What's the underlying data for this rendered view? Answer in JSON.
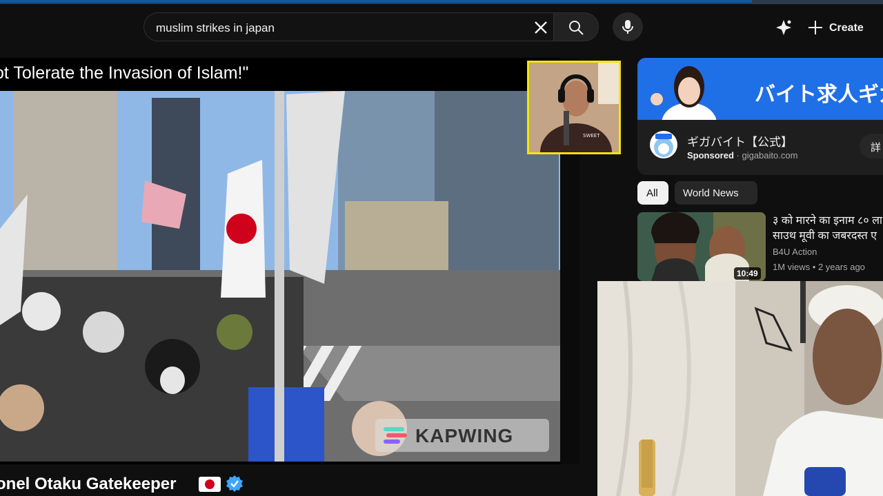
{
  "search": {
    "query": "muslim strikes in japan"
  },
  "masthead": {
    "create_label": "Create"
  },
  "player": {
    "clip_title": "ot Tolerate the Invasion of Islam!\"",
    "watermark": "KAPWING",
    "channel_name": "onel Otaku Gatekeeper"
  },
  "ad": {
    "banner_text": "バイト求人ギガたく",
    "title": "ギガバイト【公式】",
    "sponsored": "Sponsored",
    "domain": "gigabaito.com",
    "button": "詳"
  },
  "chips": [
    "All",
    "World News"
  ],
  "recommendation": {
    "title_line1": "३ को मारने का इनाम ८० ला",
    "title_line2": "साउथ मूवी का जबरदस्त ए",
    "channel": "B4U Action",
    "views": "1M views",
    "age": "2 years ago",
    "duration": "10:49"
  },
  "colors": {
    "webcam_border": "#f3e600",
    "verified": "#3ea6ff",
    "ad_banner": "#1f6fe6",
    "flag_red": "#d0021b"
  }
}
